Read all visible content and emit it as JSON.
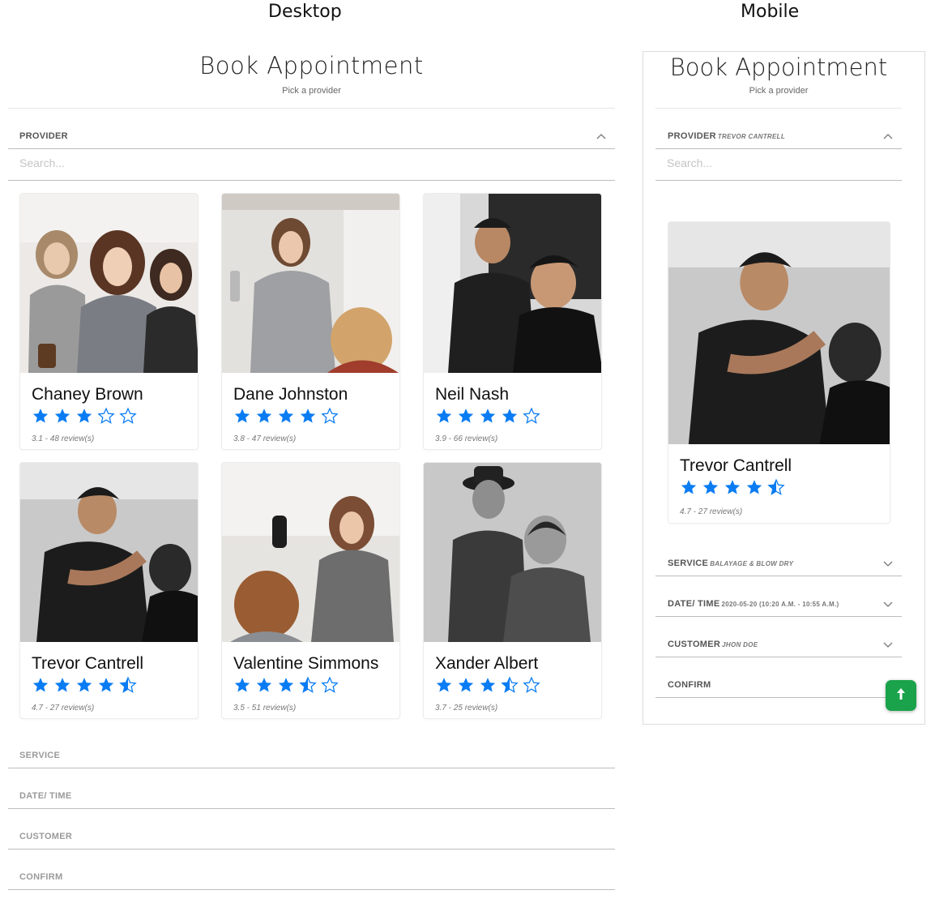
{
  "labels": {
    "desktop": "Desktop",
    "mobile": "Mobile"
  },
  "page": {
    "title": "Book Appointment",
    "subtitle": "Pick a provider"
  },
  "desktop": {
    "provider_label": "PROVIDER",
    "search_placeholder": "Search...",
    "providers": [
      {
        "name": "Chaney Brown",
        "rating": 3.1,
        "review_text": "3.1 - 48 review(s)",
        "photo_icon": "stylists-group-photo"
      },
      {
        "name": "Dane Johnston",
        "rating": 3.8,
        "review_text": "3.8 - 47 review(s)",
        "photo_icon": "stylist-spraying-photo"
      },
      {
        "name": "Neil Nash",
        "rating": 3.9,
        "review_text": "3.9 - 66 review(s)",
        "photo_icon": "barber-cutting-photo"
      },
      {
        "name": "Trevor Cantrell",
        "rating": 4.7,
        "review_text": "4.7 - 27 review(s)",
        "photo_icon": "tattooed-barber-photo"
      },
      {
        "name": "Valentine Simmons",
        "rating": 3.5,
        "review_text": "3.5 - 51 review(s)",
        "photo_icon": "blow-dry-photo"
      },
      {
        "name": "Xander Albert",
        "rating": 3.7,
        "review_text": "3.7 - 25 review(s)",
        "photo_icon": "bw-barber-photo"
      }
    ],
    "sections": [
      {
        "label": "SERVICE"
      },
      {
        "label": "DATE/ TIME"
      },
      {
        "label": "CUSTOMER"
      },
      {
        "label": "CONFIRM"
      }
    ]
  },
  "mobile": {
    "provider_label": "PROVIDER",
    "provider_value": "TREVOR CANTRELL",
    "search_placeholder": "Search...",
    "selected": {
      "name": "Trevor Cantrell",
      "rating": 4.7,
      "review_text": "4.7 - 27 review(s)"
    },
    "sections": [
      {
        "label": "SERVICE",
        "value": "BALAYAGE & BLOW DRY"
      },
      {
        "label": "DATE/ TIME",
        "value": "2020-05-20 (10:20 A.M. - 10:55 A.M.)"
      },
      {
        "label": "CUSTOMER",
        "value": "JHON DOE"
      },
      {
        "label": "CONFIRM",
        "value": ""
      }
    ]
  },
  "colors": {
    "star": "#0a7cf3",
    "fab": "#1aa34a"
  }
}
